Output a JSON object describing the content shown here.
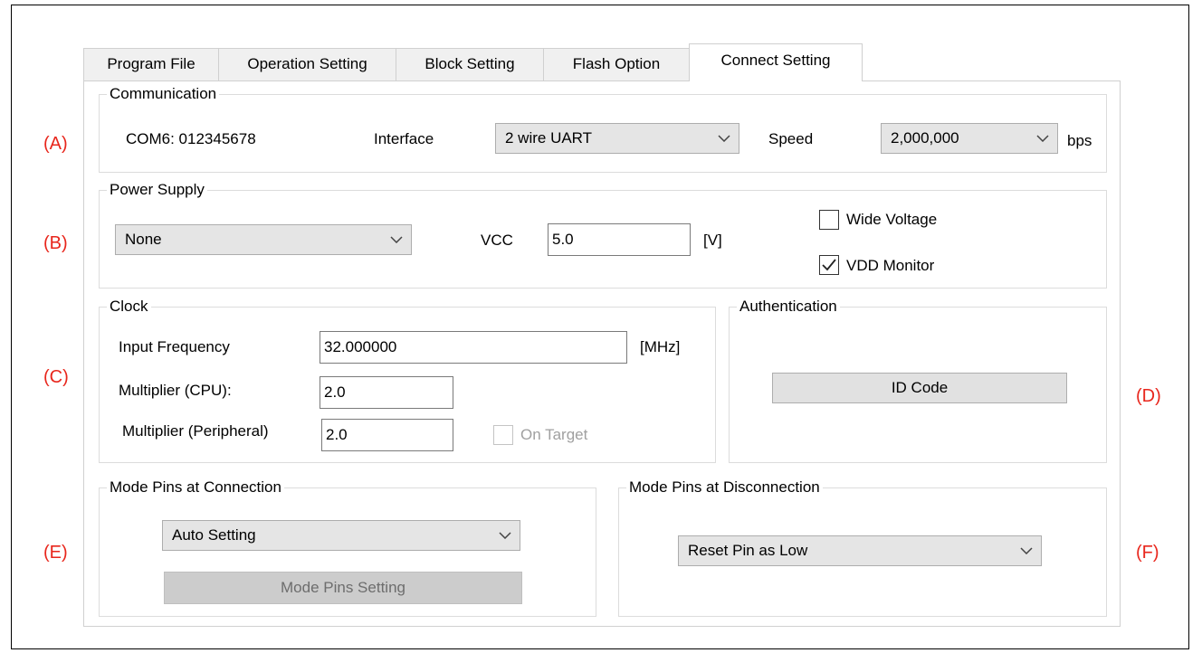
{
  "tabs": [
    {
      "label": "Program File"
    },
    {
      "label": "Operation Setting"
    },
    {
      "label": "Block Setting"
    },
    {
      "label": "Flash Option"
    },
    {
      "label": "Connect Setting"
    }
  ],
  "markers": {
    "a": "(A)",
    "b": "(B)",
    "c": "(C)",
    "d": "(D)",
    "e": "(E)",
    "f": "(F)"
  },
  "communication": {
    "legend": "Communication",
    "port": "COM6:  012345678",
    "interface_label": "Interface",
    "interface_value": "2 wire UART",
    "speed_label": "Speed",
    "speed_value": "2,000,000",
    "speed_unit": "bps"
  },
  "power": {
    "legend": "Power Supply",
    "supply_value": "None",
    "vcc_label": "VCC",
    "vcc_value": "5.0",
    "vcc_unit": "[V]",
    "wide_voltage_label": "Wide Voltage",
    "wide_voltage_checked": false,
    "vdd_monitor_label": "VDD Monitor",
    "vdd_monitor_checked": true
  },
  "clock": {
    "legend": "Clock",
    "input_freq_label": "Input Frequency",
    "input_freq_value": "32.000000",
    "input_freq_unit": "[MHz]",
    "mult_cpu_label": "Multiplier (CPU):",
    "mult_cpu_value": "2.0",
    "mult_periph_label": "Multiplier (Peripheral)",
    "mult_periph_value": "2.0",
    "on_target_label": "On Target",
    "on_target_checked": false
  },
  "auth": {
    "legend": "Authentication",
    "id_code_label": "ID Code"
  },
  "mode_connect": {
    "legend": "Mode Pins at Connection",
    "value": "Auto Setting",
    "button_label": "Mode Pins Setting"
  },
  "mode_disconnect": {
    "legend": "Mode Pins at Disconnection",
    "value": "Reset Pin as Low"
  }
}
